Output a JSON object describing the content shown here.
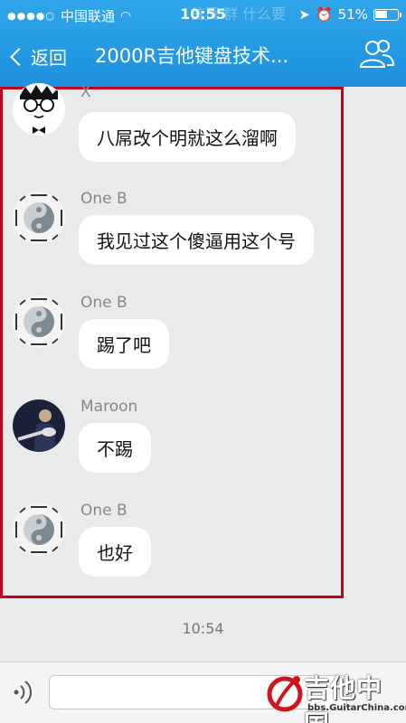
{
  "status": {
    "carrier": "中国联通",
    "time": "10:55",
    "battery": "51%"
  },
  "header": {
    "back_label": "返回",
    "title": "2000R吉他键盘技术...",
    "ghost_text": "首页 群 什么要"
  },
  "messages": [
    {
      "name": "X",
      "text": "八屌改个明就这么溜啊",
      "avatar": "cartoon-glasses-avatar"
    },
    {
      "name": "One B",
      "text": "我见过这个傻逼用这个号",
      "avatar": "yin-yang-avatar"
    },
    {
      "name": "One B",
      "text": "踢了吧",
      "avatar": "yin-yang-avatar"
    },
    {
      "name": "Maroon",
      "text": "不踢",
      "avatar": "guitarist-photo-avatar"
    },
    {
      "name": "One B",
      "text": "也好",
      "avatar": "yin-yang-avatar"
    }
  ],
  "timestamp": "10:54",
  "watermark": {
    "main": "吉他中国",
    "sub": "bbs.GuitarChina.com"
  },
  "colors": {
    "header": "#1e90de",
    "highlight_border": "#c3001c",
    "background": "#e9eaec"
  }
}
